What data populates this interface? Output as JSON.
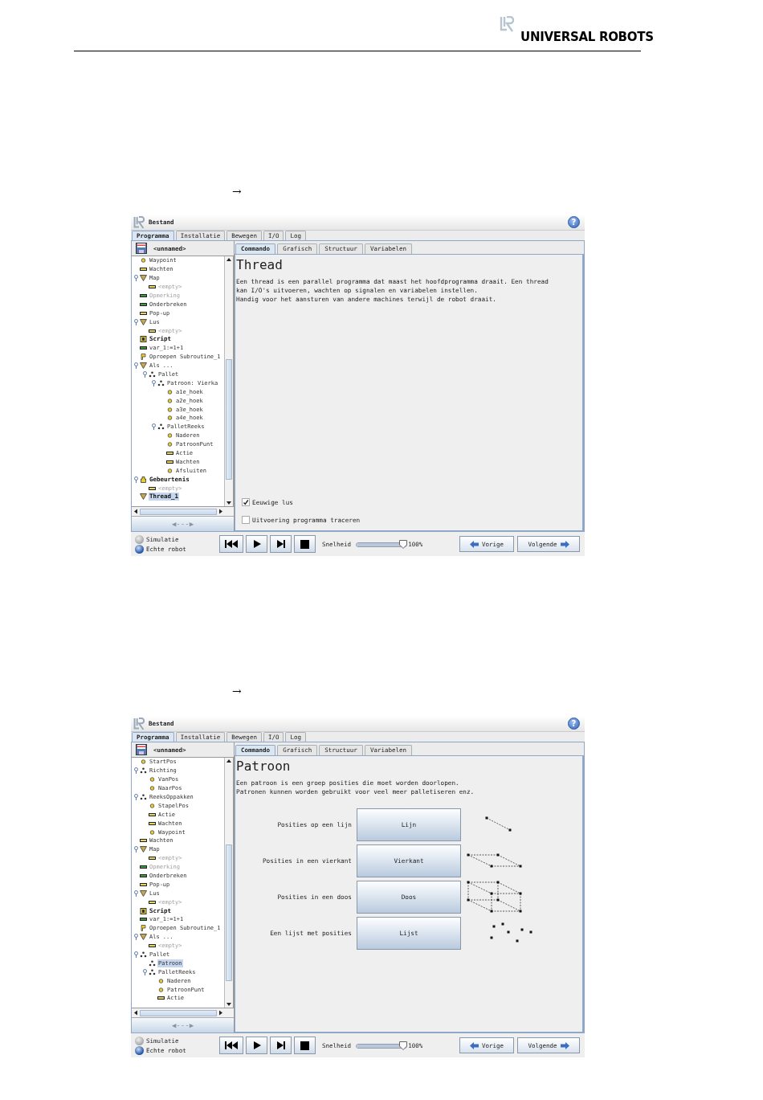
{
  "header": {
    "logo_text": "UNIVERSAL ROBOTS"
  },
  "sections": [
    {
      "arrow": "→",
      "screen": {
        "menu": "Bestand",
        "help": "?",
        "main_tabs": [
          {
            "label": "Programma",
            "selected": true
          },
          {
            "label": "Installatie",
            "selected": false
          },
          {
            "label": "Bewegen",
            "selected": false
          },
          {
            "label": "I/O",
            "selected": false
          },
          {
            "label": "Log",
            "selected": false
          }
        ],
        "program_name": "<unnamed>",
        "tree": [
          {
            "label": "Waypoint",
            "kind": "waypoint",
            "selected": false
          },
          {
            "label": "Wachten",
            "kind": "wait",
            "selected": false
          },
          {
            "label": "Map",
            "kind": "folder",
            "selected": false,
            "children": [
              {
                "label": "<empty>",
                "kind": "empty",
                "selected": false
              }
            ]
          },
          {
            "label": "Opmerking",
            "kind": "comment",
            "selected": false
          },
          {
            "label": "Onderbreken",
            "kind": "halt",
            "selected": false
          },
          {
            "label": "Pop-up",
            "kind": "wait",
            "selected": false
          },
          {
            "label": "Lus",
            "kind": "folder",
            "selected": false,
            "children": [
              {
                "label": "<empty>",
                "kind": "empty",
                "selected": false
              }
            ]
          },
          {
            "label": "Script",
            "kind": "script",
            "selected": false
          },
          {
            "label": "var_1:=1+1",
            "kind": "halt",
            "selected": false
          },
          {
            "label": "Oproepen Subroutine_1",
            "kind": "call",
            "selected": false
          },
          {
            "label": "Als ...",
            "kind": "folder",
            "selected": false,
            "children": [
              {
                "label": "Pallet",
                "kind": "pallet",
                "selected": false,
                "children": [
                  {
                    "label": "Patroon: Vierka",
                    "kind": "pallet",
                    "selected": false,
                    "children": [
                      {
                        "label": "a1e_hoek",
                        "kind": "waypoint",
                        "selected": false
                      },
                      {
                        "label": "a2e_hoek",
                        "kind": "waypoint",
                        "selected": false
                      },
                      {
                        "label": "a3e_hoek",
                        "kind": "waypoint",
                        "selected": false
                      },
                      {
                        "label": "a4e_hoek",
                        "kind": "waypoint",
                        "selected": false
                      }
                    ]
                  },
                  {
                    "label": "PalletReeks",
                    "kind": "pallet",
                    "selected": false,
                    "children": [
                      {
                        "label": "Naderen",
                        "kind": "waypoint",
                        "selected": false
                      },
                      {
                        "label": "PatroonPunt",
                        "kind": "waypoint",
                        "selected": false
                      },
                      {
                        "label": "Actie",
                        "kind": "wait",
                        "selected": false
                      },
                      {
                        "label": "Wachten",
                        "kind": "wait",
                        "selected": false
                      },
                      {
                        "label": "Afsluiten",
                        "kind": "waypoint",
                        "selected": false
                      }
                    ]
                  }
                ]
              }
            ]
          },
          {
            "label": "Gebeurtenis",
            "kind": "event",
            "selected": false,
            "children": [
              {
                "label": "<empty>",
                "kind": "empty",
                "selected": false
              }
            ]
          },
          {
            "label": "Thread_1",
            "kind": "thread",
            "selected": true
          }
        ],
        "nav_button": "◀---▶",
        "sub_tabs": [
          {
            "label": "Commando",
            "selected": true
          },
          {
            "label": "Grafisch",
            "selected": false
          },
          {
            "label": "Structuur",
            "selected": false
          },
          {
            "label": "Variabelen",
            "selected": false
          }
        ],
        "content": {
          "kind": "thread",
          "title": "Thread",
          "description": "Een thread is een parallel programma dat maast het hoofdprogramma draait. Een thread\nkan I/O's uitvoeren, wachten op signalen en variabelen instellen.\nHandig voor het aansturen van andere machines terwijl de robot draait.",
          "options": [
            {
              "label": "Eeuwige lus",
              "checked": true
            },
            {
              "label": "Uitvoering programma traceren",
              "checked": false
            }
          ]
        },
        "modes": [
          {
            "label": "Simulatie",
            "selected": false
          },
          {
            "label": "Echte robot",
            "selected": true
          }
        ],
        "speed_label": "Snelheid",
        "speed": {
          "level": 1,
          "reading": "100%"
        },
        "buttons": [
          {
            "label": "Vorige",
            "kind": "back"
          },
          {
            "label": "Volgende",
            "kind": "next"
          }
        ]
      }
    },
    {
      "arrow": "→",
      "screen": {
        "menu": "Bestand",
        "help": "?",
        "main_tabs": [
          {
            "label": "Programma",
            "selected": true
          },
          {
            "label": "Installatie",
            "selected": false
          },
          {
            "label": "Bewegen",
            "selected": false
          },
          {
            "label": "I/O",
            "selected": false
          },
          {
            "label": "Log",
            "selected": false
          }
        ],
        "program_name": "<unnamed>",
        "tree": [
          {
            "label": "StartPos",
            "kind": "waypoint",
            "selected": false
          },
          {
            "label": "Richting",
            "kind": "pallet",
            "selected": false,
            "children": [
              {
                "label": "VanPos",
                "kind": "waypoint",
                "selected": false
              },
              {
                "label": "NaarPos",
                "kind": "waypoint",
                "selected": false
              }
            ]
          },
          {
            "label": "ReeksOppakken",
            "kind": "pallet",
            "selected": false,
            "children": [
              {
                "label": "StapelPos",
                "kind": "waypoint",
                "selected": false
              },
              {
                "label": "Actie",
                "kind": "wait",
                "selected": false
              },
              {
                "label": "Wachten",
                "kind": "wait",
                "selected": false
              },
              {
                "label": "Waypoint",
                "kind": "waypoint",
                "selected": false
              }
            ]
          },
          {
            "label": "Wachten",
            "kind": "wait",
            "selected": false
          },
          {
            "label": "Map",
            "kind": "folder",
            "selected": false,
            "children": [
              {
                "label": "<empty>",
                "kind": "empty",
                "selected": false
              }
            ]
          },
          {
            "label": "Opmerking",
            "kind": "comment",
            "selected": false
          },
          {
            "label": "Onderbreken",
            "kind": "halt",
            "selected": false
          },
          {
            "label": "Pop-up",
            "kind": "wait",
            "selected": false
          },
          {
            "label": "Lus",
            "kind": "folder",
            "selected": false,
            "children": [
              {
                "label": "<empty>",
                "kind": "empty",
                "selected": false
              }
            ]
          },
          {
            "label": "Script",
            "kind": "script",
            "selected": false
          },
          {
            "label": "var_1:=1+1",
            "kind": "halt",
            "selected": false
          },
          {
            "label": "Oproepen Subroutine_1",
            "kind": "call",
            "selected": false
          },
          {
            "label": "Als ...",
            "kind": "folder",
            "selected": false,
            "children": [
              {
                "label": "<empty>",
                "kind": "empty",
                "selected": false
              }
            ]
          },
          {
            "label": "Pallet",
            "kind": "pallet",
            "selected": false,
            "children": [
              {
                "label": "Patroon",
                "kind": "pallet",
                "selected": true
              },
              {
                "label": "PalletReeks",
                "kind": "pallet",
                "selected": false,
                "children": [
                  {
                    "label": "Naderen",
                    "kind": "waypoint",
                    "selected": false
                  },
                  {
                    "label": "PatroonPunt",
                    "kind": "waypoint",
                    "selected": false
                  },
                  {
                    "label": "Actie",
                    "kind": "wait",
                    "selected": false
                  }
                ]
              }
            ]
          }
        ],
        "nav_button": "◀---▶",
        "sub_tabs": [
          {
            "label": "Commando",
            "selected": true
          },
          {
            "label": "Grafisch",
            "selected": false
          },
          {
            "label": "Structuur",
            "selected": false
          },
          {
            "label": "Variabelen",
            "selected": false
          }
        ],
        "content": {
          "kind": "pattern",
          "title": "Patroon",
          "description": "Een patroon is een groep posities die moet worden doorlopen.\nPatronen kunnen worden gebruikt voor veel meer palletiseren enz.",
          "patterns": [
            {
              "label": "Posities op een lijn",
              "button": "Lijn",
              "kind": "line"
            },
            {
              "label": "Posities in een vierkant",
              "button": "Vierkant",
              "kind": "square"
            },
            {
              "label": "Posities in een doos",
              "button": "Doos",
              "kind": "box"
            },
            {
              "label": "Een lijst met posities",
              "button": "Lijst",
              "kind": "list"
            }
          ]
        },
        "modes": [
          {
            "label": "Simulatie",
            "selected": false
          },
          {
            "label": "Echte robot",
            "selected": true
          }
        ],
        "speed_label": "Snelheid",
        "speed": {
          "level": 1,
          "reading": "100%"
        },
        "buttons": [
          {
            "label": "Vorige",
            "kind": "back"
          },
          {
            "label": "Volgende",
            "kind": "next"
          }
        ]
      }
    }
  ]
}
